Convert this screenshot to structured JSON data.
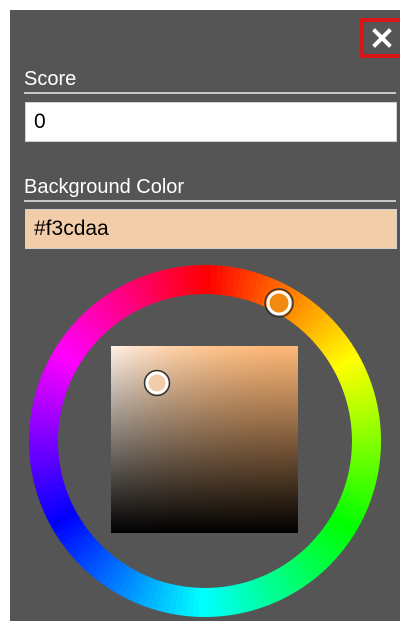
{
  "close_button": {
    "icon": "close-icon",
    "glyph": "x",
    "highlight_color": "#d9141b"
  },
  "score": {
    "label": "Score",
    "value": "0"
  },
  "background_color": {
    "label": "Background Color",
    "value": "#f3cdaa",
    "swatch": "#f3cdaa"
  },
  "color_picker": {
    "hue_handle_color": "#f18a11",
    "saturation_handle_color": "#f3cdaa"
  },
  "theme": {
    "panel_bg": "#555555",
    "label_color": "#ffffff"
  }
}
